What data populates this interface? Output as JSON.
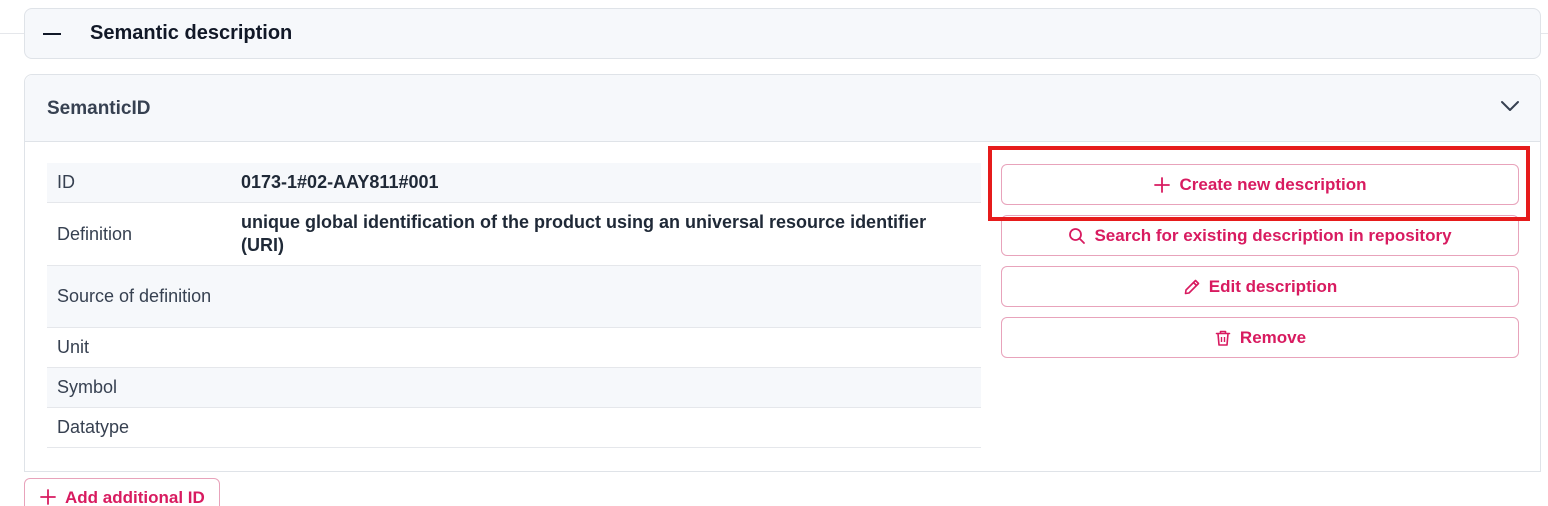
{
  "section": {
    "title": "Semantic description",
    "collapse_icon": "minus-icon"
  },
  "panel": {
    "title": "SemanticID",
    "toggle_icon": "chevron-down-icon"
  },
  "table": {
    "rows": [
      {
        "key": "ID",
        "value": "0173-1#02-AAY811#001"
      },
      {
        "key": "Definition",
        "value": "unique global identification of the product using an universal resource identifier (URI)"
      },
      {
        "key": "Source of definition",
        "value": ""
      },
      {
        "key": "Unit",
        "value": ""
      },
      {
        "key": "Symbol",
        "value": ""
      },
      {
        "key": "Datatype",
        "value": ""
      }
    ]
  },
  "actions": {
    "create_label": "Create new description",
    "search_label": "Search for existing description in repository",
    "edit_label": "Edit description",
    "remove_label": "Remove"
  },
  "footer": {
    "add_id_label": "Add additional ID"
  },
  "colors": {
    "accent": "#d81b60",
    "highlight": "#e61b1b",
    "header_bg": "#f6f8fb"
  }
}
